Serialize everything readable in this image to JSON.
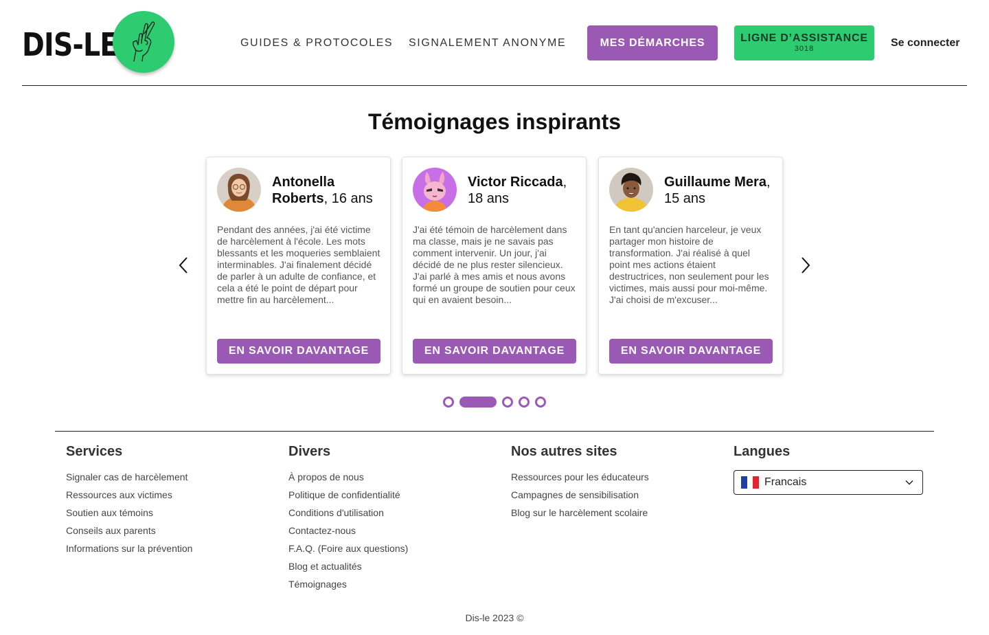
{
  "header": {
    "logo_text": "DIS-LE",
    "nav": {
      "guides": "GUIDES & PROTOCOLES",
      "signalement": "SIGNALEMENT ANONYME"
    },
    "demarches_button": "MES DÉMARCHES",
    "assistance_button": {
      "label": "LIGNE D’ASSISTANCE",
      "number": "3018"
    },
    "login": "Se connecter"
  },
  "testimonials": {
    "title": "Témoignages inspirants",
    "cards": [
      {
        "name": "Antonella Roberts",
        "age": ", 16 ans",
        "text": "Pendant des années, j'ai été victime de harcèlement à l'école. Les mots blessants et les moqueries semblaient interminables. J'ai finalement décidé de parler à un adulte de confiance, et cela a été le point de départ pour mettre fin au harcèlement...",
        "button": "EN SAVOIR DAVANTAGE"
      },
      {
        "name": "Victor Riccada",
        "age": ", 18 ans",
        "text": "J'ai été témoin de harcèlement dans ma classe, mais je ne savais pas comment intervenir. Un jour, j'ai décidé de ne plus rester silencieux. J'ai parlé à mes amis et nous avons formé un groupe de soutien pour ceux qui en avaient besoin...",
        "button": "EN SAVOIR DAVANTAGE"
      },
      {
        "name": "Guillaume Mera",
        "age": ", 15 ans",
        "text": "En tant qu'ancien harceleur, je veux partager mon histoire de transformation. J'ai réalisé à quel point mes actions étaient destructrices, non seulement pour les victimes, mais aussi pour moi-même. J'ai choisi de m'excuser...",
        "button": "EN SAVOIR DAVANTAGE"
      }
    ],
    "carousel": {
      "pages": 5,
      "active_index": 1
    }
  },
  "footer": {
    "services": {
      "title": "Services",
      "links": [
        "Signaler cas de harcèlement",
        "Ressources aux victimes",
        "Soutien aux témoins",
        "Conseils aux parents",
        "Informations sur la prévention"
      ]
    },
    "divers": {
      "title": "Divers",
      "links": [
        "À propos de nous",
        "Politique de confidentialité",
        "Conditions d'utilisation",
        "Contactez-nous",
        "F.A.Q. (Foire aux questions)",
        "Blog et actualités",
        "Témoignages"
      ]
    },
    "autres_sites": {
      "title": "Nos autres sites",
      "links": [
        "Ressources pour les éducateurs",
        "Campagnes de sensibilisation",
        "Blog sur le harcèlement scolaire"
      ]
    },
    "langues": {
      "title": "Langues",
      "selected": "Francais"
    },
    "copyright": "Dis-le 2023 ©"
  },
  "colors": {
    "purple": "#9b59b6",
    "green": "#2ecc71"
  },
  "icons": [
    "crossed-fingers-icon",
    "chevron-left-icon",
    "chevron-right-icon",
    "chevron-down-icon",
    "flag-france-icon"
  ]
}
